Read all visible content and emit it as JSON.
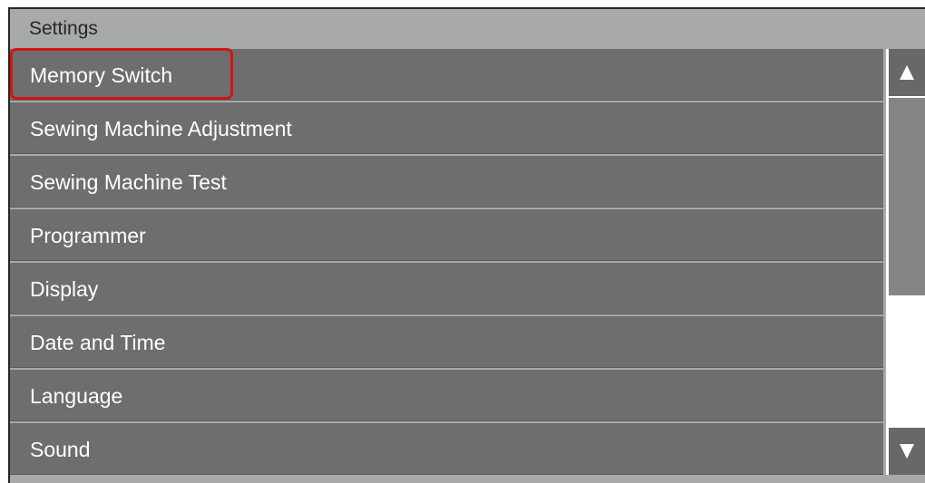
{
  "header": {
    "title": "Settings"
  },
  "menu": {
    "items": [
      {
        "label": "Memory Switch",
        "selected": true
      },
      {
        "label": "Sewing Machine Adjustment",
        "selected": false
      },
      {
        "label": "Sewing Machine Test",
        "selected": false
      },
      {
        "label": "Programmer",
        "selected": false
      },
      {
        "label": "Display",
        "selected": false
      },
      {
        "label": "Date and Time",
        "selected": false
      },
      {
        "label": "Language",
        "selected": false
      },
      {
        "label": "Sound",
        "selected": false
      }
    ]
  },
  "scrollbar": {
    "up_icon": "triangle-up-icon",
    "down_icon": "triangle-down-icon",
    "thumb_position": 0.0,
    "visible_fraction": 0.6
  },
  "colors": {
    "header_bg": "#a7aaa7",
    "item_bg": "#6e6e6e",
    "item_text": "#ffffff",
    "highlight": "#d41414",
    "scroll_button_bg": "#686868",
    "scroll_thumb": "#858585"
  }
}
